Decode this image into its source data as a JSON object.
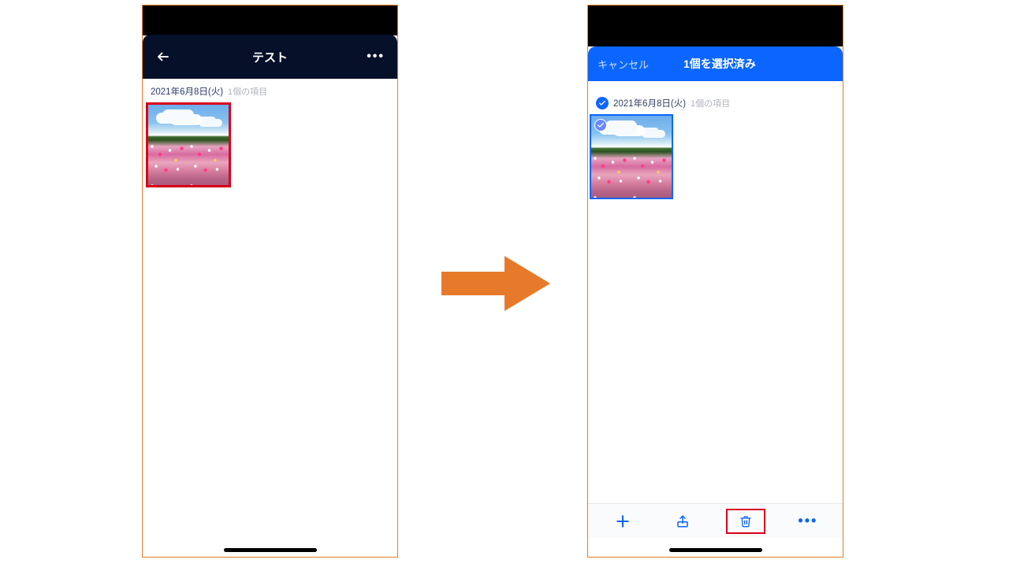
{
  "left": {
    "header": {
      "title": "テスト"
    },
    "date_row": {
      "date": "2021年6月8日(火)",
      "count": "1個の項目"
    }
  },
  "right": {
    "header": {
      "cancel": "キャンセル",
      "title": "1個を選択済み"
    },
    "date_row": {
      "date": "2021年6月8日(火)",
      "count": "1個の項目"
    }
  }
}
